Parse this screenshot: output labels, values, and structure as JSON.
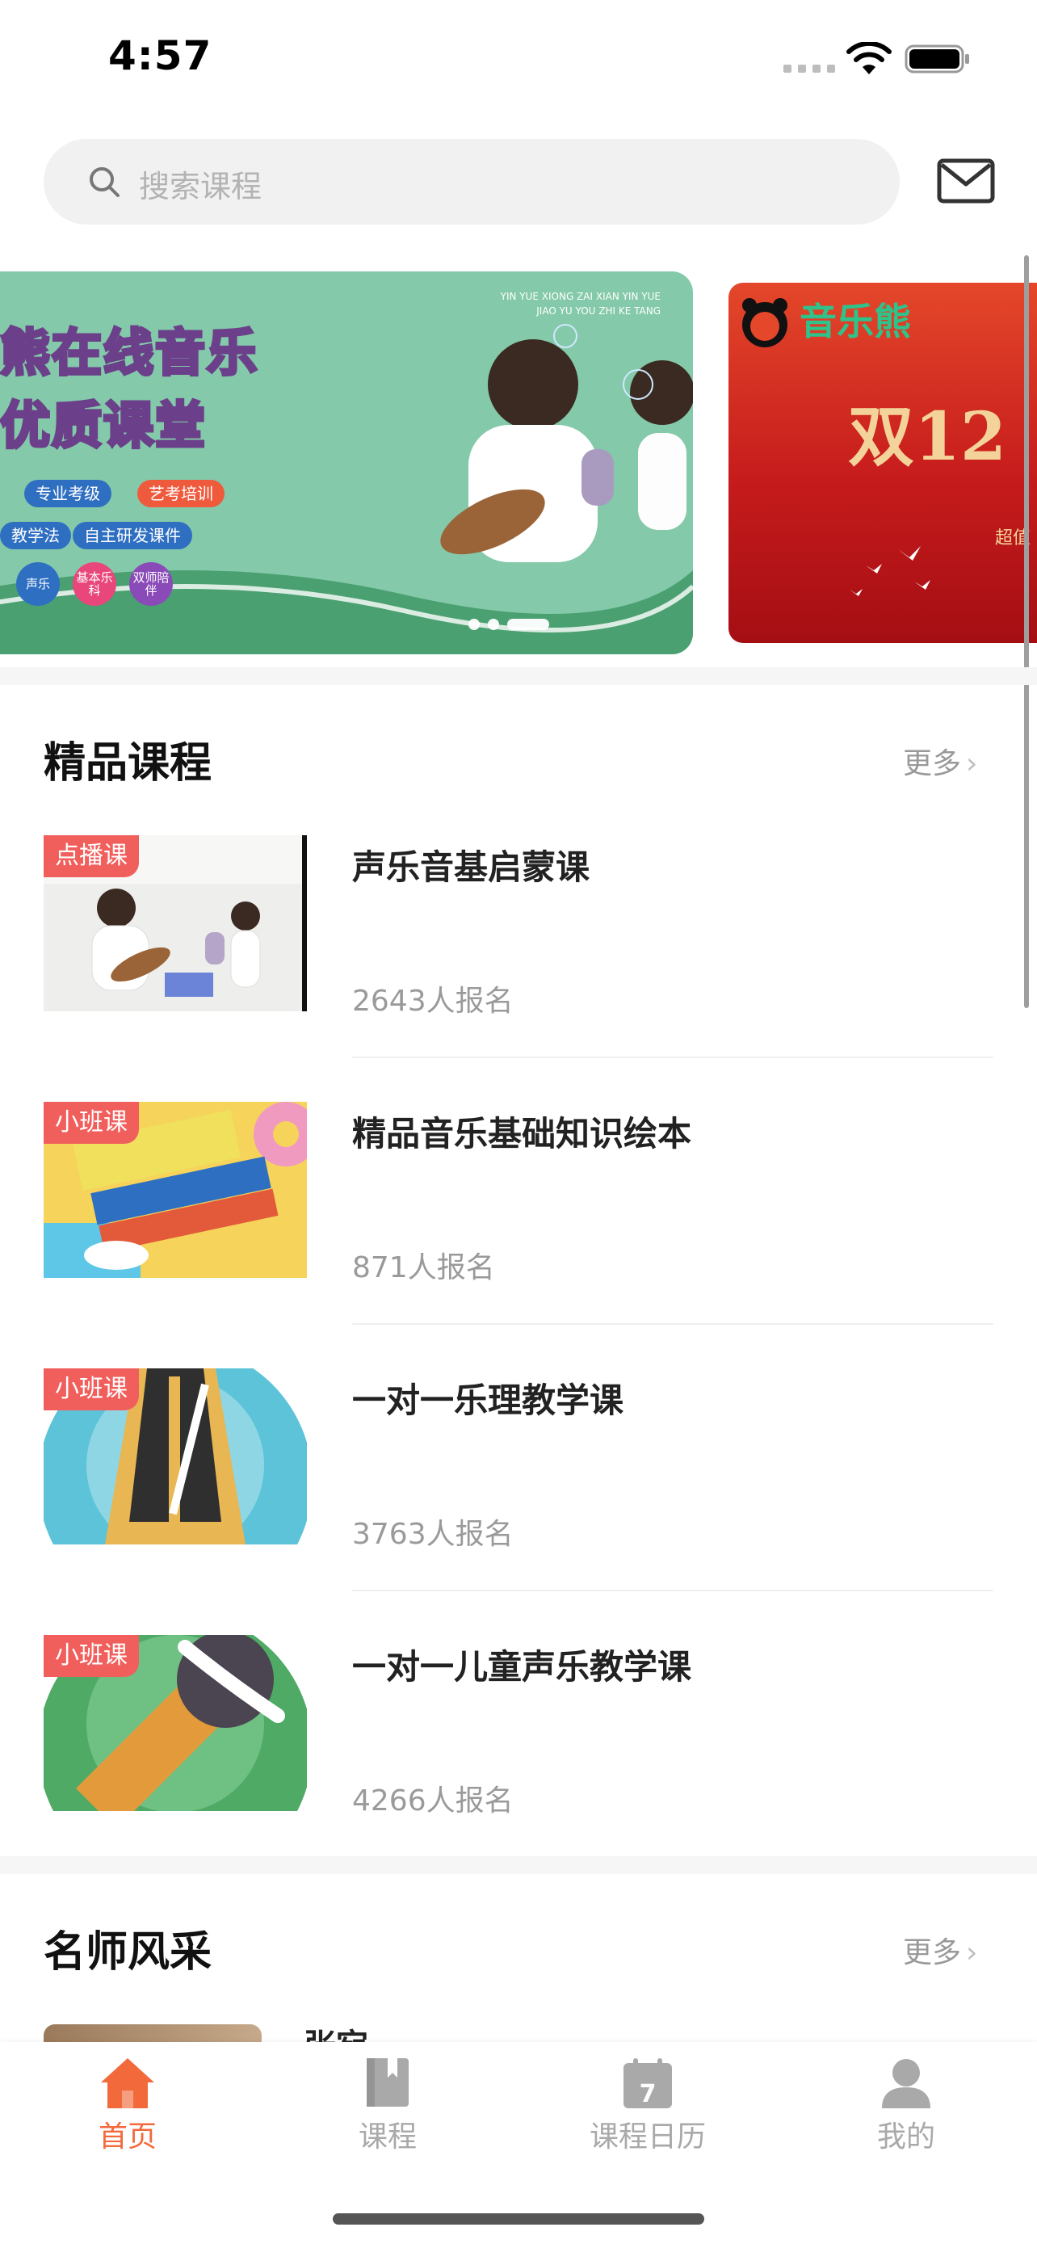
{
  "status_bar": {
    "time": "4:57"
  },
  "search": {
    "placeholder": "搜索课程"
  },
  "banner": {
    "headline_line1": "熊在线音乐",
    "headline_line2": "优质课堂",
    "small_text_1": "YIN YUE XIONG ZAI XIAN YIN YUE",
    "small_text_2": "JIAO YU YOU ZHI KE TANG",
    "tags_row1": [
      "专业考级",
      "艺考培训"
    ],
    "tags_row2": [
      "教学法",
      "自主研发课件"
    ],
    "circles": [
      "声乐",
      "基本乐科",
      "双师陪伴"
    ],
    "side_brand": "音乐熊",
    "side_headline": "双12",
    "side_sub": "超值"
  },
  "featured": {
    "title": "精品课程",
    "more": "更多",
    "courses": [
      {
        "badge": "点播课",
        "title": "声乐音基启蒙课",
        "count": "2643人报名"
      },
      {
        "badge": "小班课",
        "title": "精品音乐基础知识绘本",
        "count": "871人报名"
      },
      {
        "badge": "小班课",
        "title": "一对一乐理教学课",
        "count": "3763人报名"
      },
      {
        "badge": "小班课",
        "title": "一对一儿童声乐教学课",
        "count": "4266人报名"
      }
    ]
  },
  "teachers": {
    "title": "名师风采",
    "more": "更多",
    "first_name": "张宛"
  },
  "tab_bar": {
    "items": [
      {
        "label": "首页",
        "icon": "home-icon",
        "active": true
      },
      {
        "label": "课程",
        "icon": "book-icon",
        "active": false
      },
      {
        "label": "课程日历",
        "icon": "calendar-icon",
        "active": false,
        "day": "7"
      },
      {
        "label": "我的",
        "icon": "person-icon",
        "active": false
      }
    ],
    "active_color": "#f26a3c",
    "inactive_color": "#a9a9a9"
  }
}
